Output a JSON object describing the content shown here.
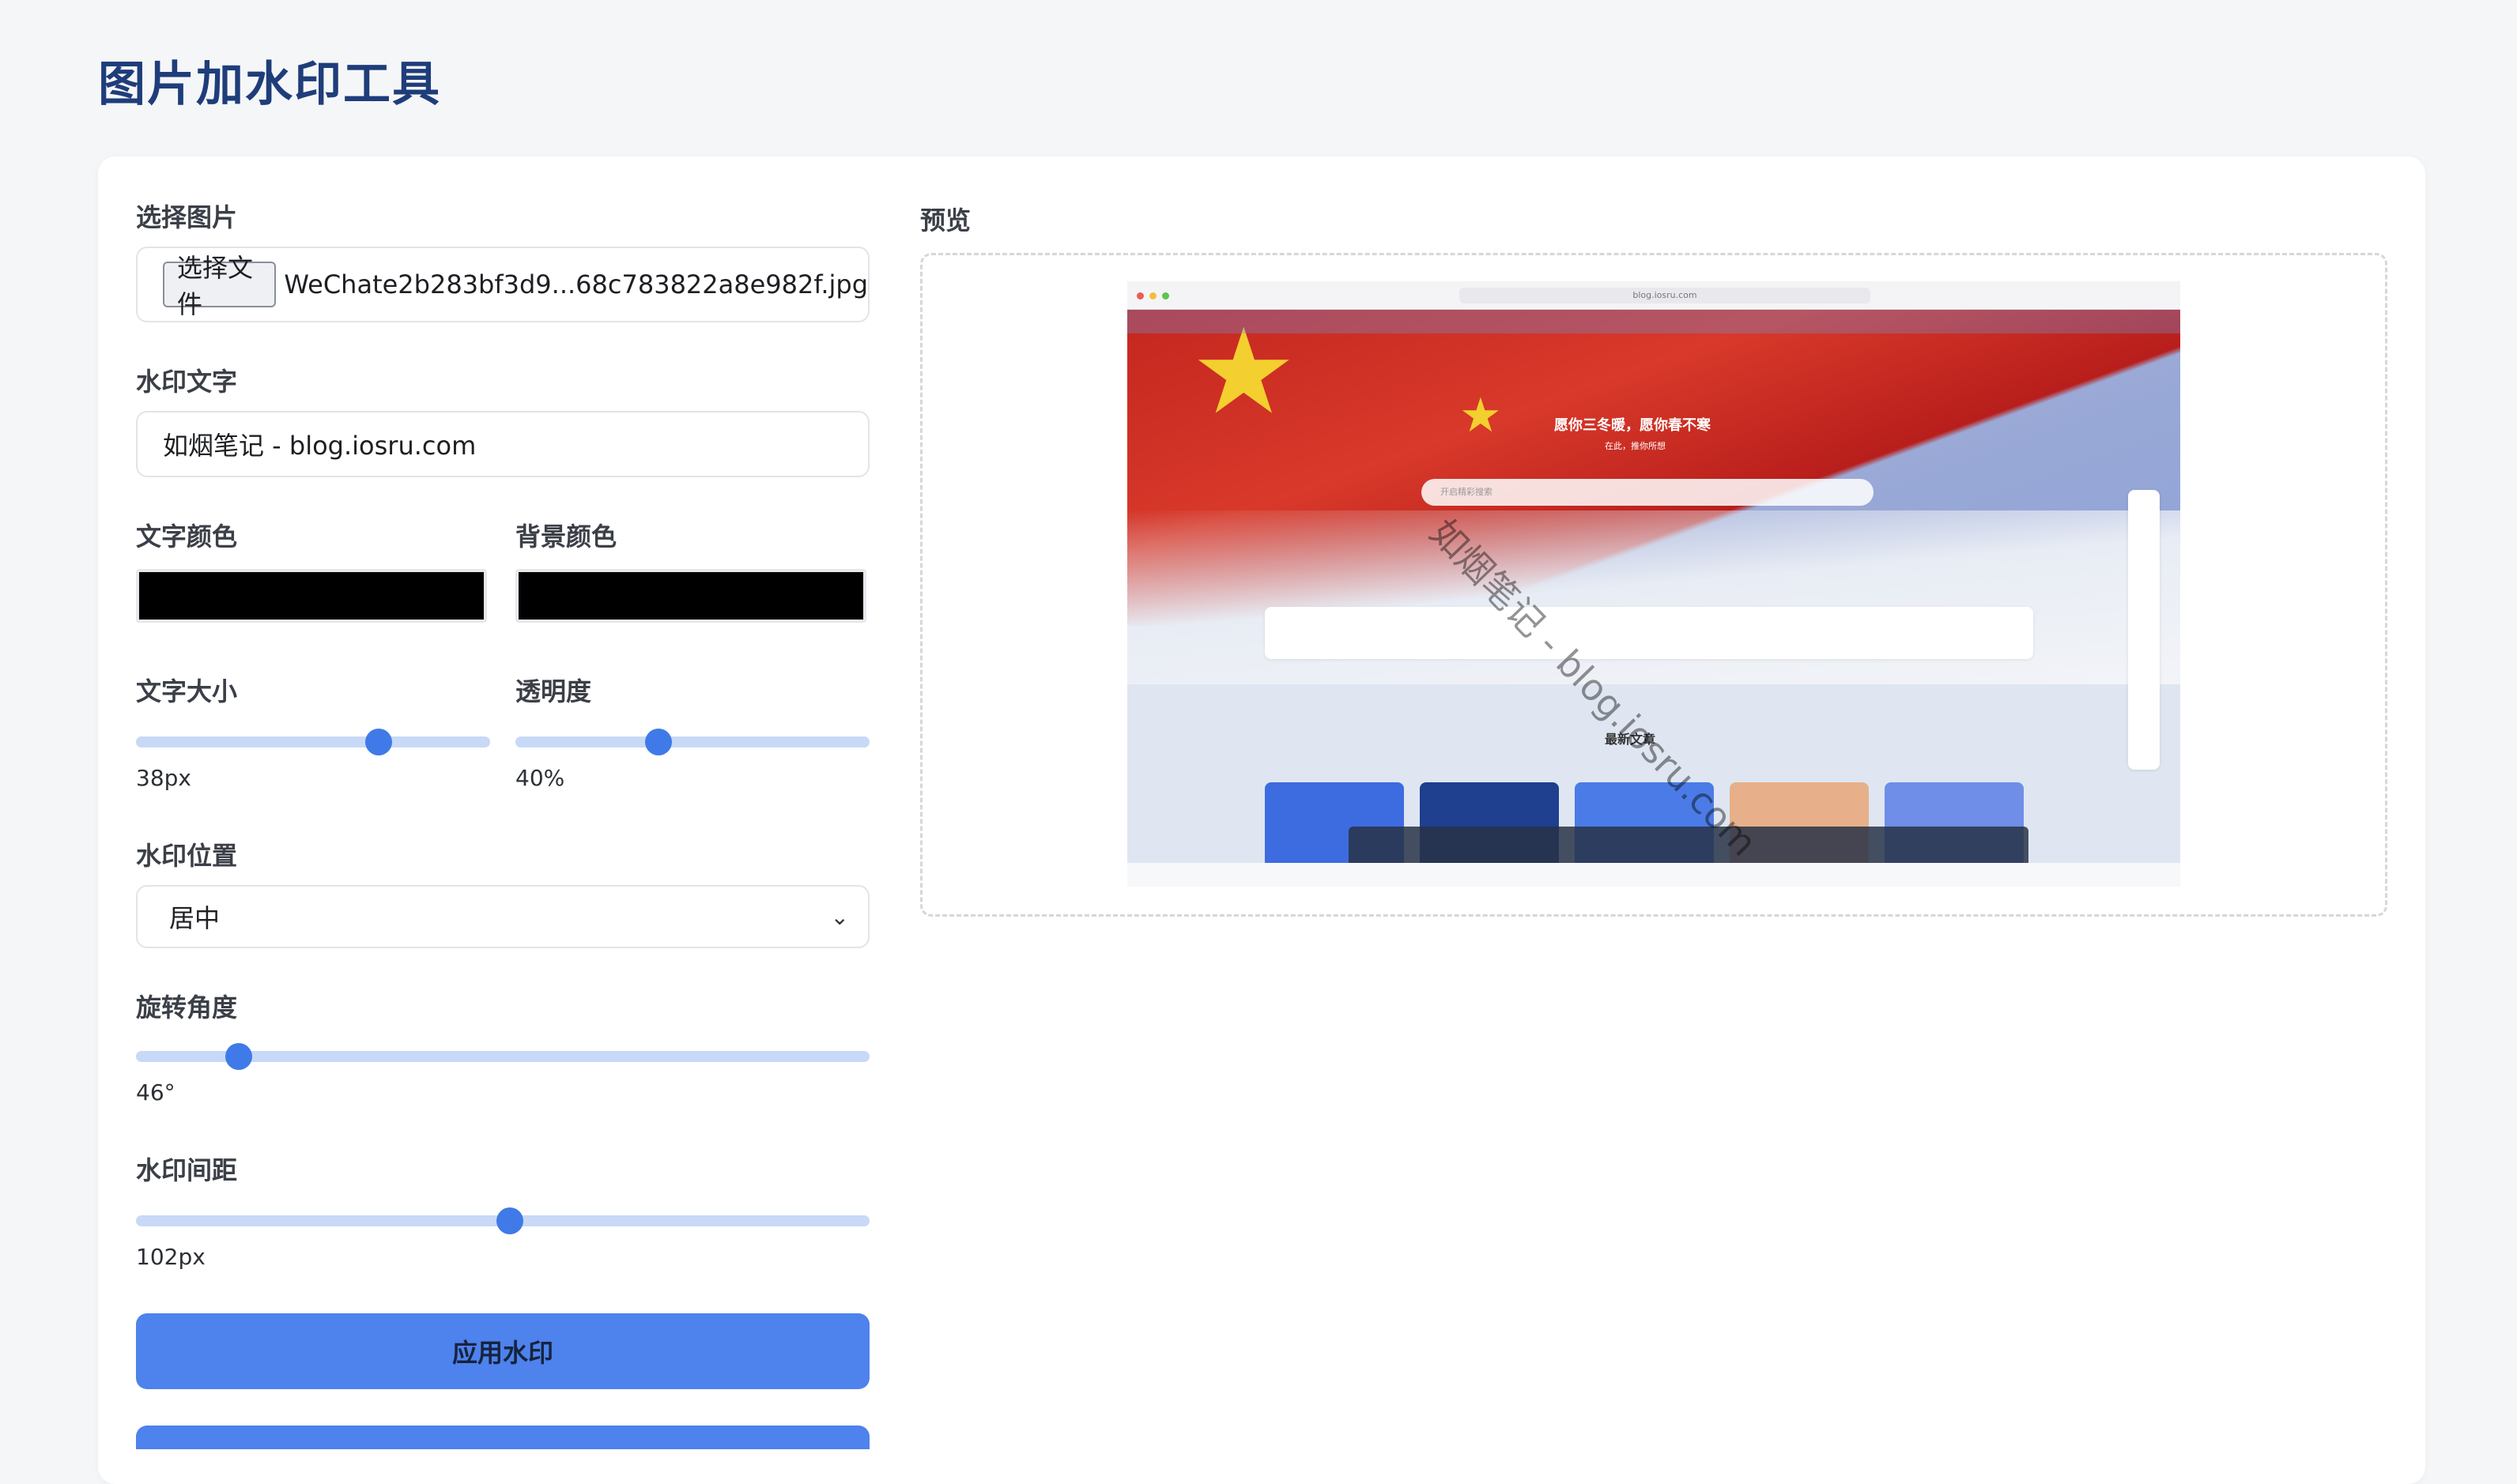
{
  "page": {
    "title": "图片加水印工具"
  },
  "form": {
    "file": {
      "label": "选择图片",
      "button_label": "选择文件",
      "file_name": "WeChate2b283bf3d9...68c783822a8e982f.jpg"
    },
    "watermark_text": {
      "label": "水印文字",
      "value": "如烟笔记 - blog.iosru.com"
    },
    "text_color": {
      "label": "文字颜色",
      "value": "#000000"
    },
    "background_color": {
      "label": "背景颜色",
      "value": "#000000"
    },
    "font_size": {
      "label": "文字大小",
      "display": "38px",
      "value": 38
    },
    "opacity": {
      "label": "透明度",
      "display": "40%",
      "value": 40
    },
    "position": {
      "label": "水印位置",
      "selected": "居中"
    },
    "rotation": {
      "label": "旋转角度",
      "display": "46°",
      "value": 46
    },
    "spacing": {
      "label": "水印间距",
      "display": "102px",
      "value": 102
    },
    "apply_button": "应用水印"
  },
  "preview": {
    "label": "预览",
    "overlay_text": "如烟笔记 - blog.iosru.com",
    "screenshot": {
      "url": "blog.iosru.com",
      "hero_title": "愿你三冬暖，愿你春不寒",
      "hero_subtitle": "在此，推你所想",
      "search_placeholder": "开启精彩搜索",
      "section_title": "最新文章"
    }
  },
  "colors": {
    "accent": "#4e82ec",
    "title": "#1f3d7a",
    "slider_track": "#c7d9f6",
    "slider_thumb": "#3f7ae8"
  }
}
